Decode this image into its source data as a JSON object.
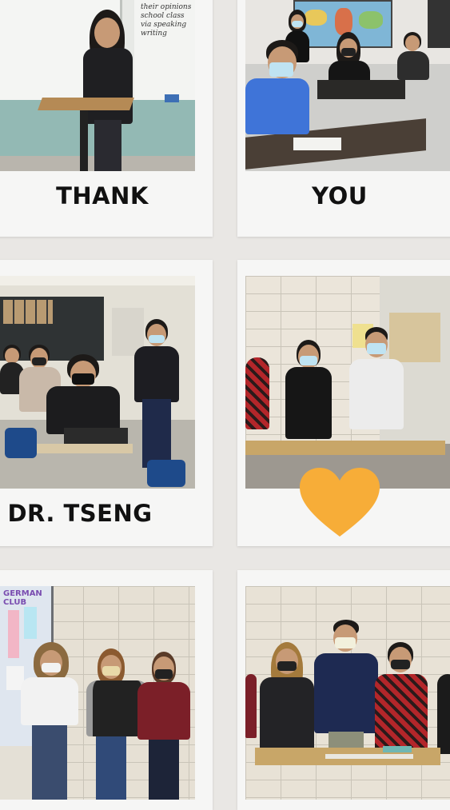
{
  "cards": {
    "c1": {
      "caption": ""
    },
    "c2": {
      "caption": "THANK"
    },
    "c3": {
      "caption": "YOU"
    },
    "c4": {
      "caption": "DR. TSENG"
    },
    "c5": {
      "caption": ""
    },
    "c6": {
      "caption": ""
    },
    "c7": {
      "caption": ""
    }
  },
  "whiteboard_text": [
    "their opinions",
    "school class",
    "via speaking",
    "writing"
  ],
  "club_sign": "GERMAN CLUB",
  "icons": {
    "heart": "heart-icon"
  },
  "colors": {
    "background": "#e9e7e4",
    "card": "#f6f6f5",
    "heart": "#f7ad38",
    "caption_text": "#111111"
  }
}
